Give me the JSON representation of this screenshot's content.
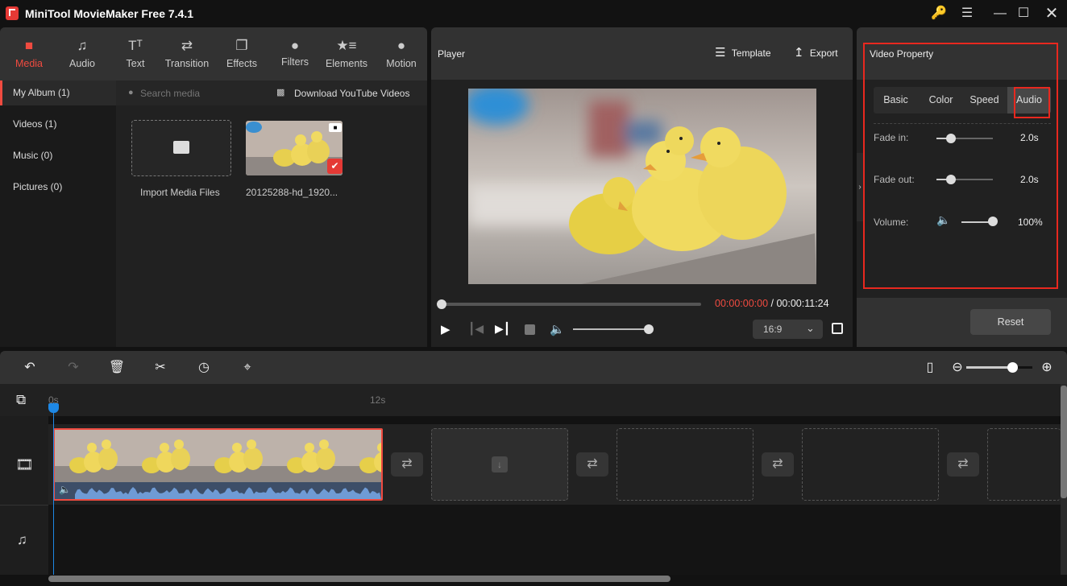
{
  "app": {
    "title": "MiniTool MovieMaker Free 7.4.1"
  },
  "window_controls": {
    "key": "key-icon",
    "menu": "menu-icon",
    "minimize": "minimize-icon",
    "maximize": "maximize-icon",
    "close": "close-icon"
  },
  "nav_tabs": [
    {
      "label": "Media",
      "icon": "folder-icon",
      "active": true
    },
    {
      "label": "Audio",
      "icon": "music-icon"
    },
    {
      "label": "Text",
      "icon": "text-icon"
    },
    {
      "label": "Transition",
      "icon": "transition-icon"
    },
    {
      "label": "Effects",
      "icon": "effects-icon"
    },
    {
      "label": "Filters",
      "icon": "filters-icon"
    },
    {
      "label": "Elements",
      "icon": "elements-icon"
    },
    {
      "label": "Motion",
      "icon": "motion-icon"
    }
  ],
  "album": [
    {
      "label": "My Album (1)",
      "active": true
    },
    {
      "label": "Videos (1)"
    },
    {
      "label": "Music (0)"
    },
    {
      "label": "Pictures (0)"
    }
  ],
  "media": {
    "search_placeholder": "Search media",
    "download_label": "Download YouTube Videos",
    "import_label": "Import Media Files",
    "video_name": "20125288-hd_1920..."
  },
  "player": {
    "title": "Player",
    "template_label": "Template",
    "export_label": "Export",
    "current_time": "00:00:00:00",
    "separator": " / ",
    "total_time": "00:00:11:24",
    "progress": 0,
    "volume": 1.0,
    "aspect_ratio": "16:9"
  },
  "property": {
    "title": "Video Property",
    "tabs": [
      {
        "label": "Basic"
      },
      {
        "label": "Color"
      },
      {
        "label": "Speed"
      },
      {
        "label": "Audio",
        "active": true
      }
    ],
    "fade_in": {
      "label": "Fade in:",
      "value": "2.0s",
      "fraction": 0.2
    },
    "fade_out": {
      "label": "Fade out:",
      "value": "2.0s",
      "fraction": 0.2
    },
    "volume": {
      "label": "Volume:",
      "value": "100%",
      "fraction": 1.0
    },
    "reset_label": "Reset"
  },
  "timeline": {
    "ruler": [
      "0s",
      "12s"
    ],
    "zoom_fraction": 0.82,
    "colors": {
      "accent": "#f04b40",
      "playhead": "#1e88e5",
      "highlight": "#e8281f"
    }
  }
}
